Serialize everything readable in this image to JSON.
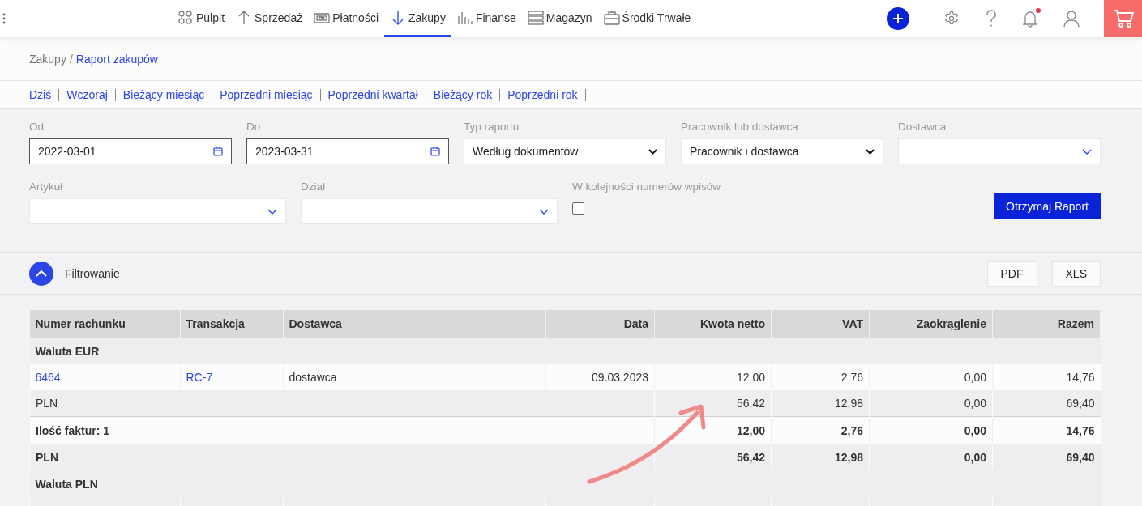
{
  "nav": {
    "items": [
      {
        "label": "Pulpit",
        "selected": false
      },
      {
        "label": "Sprzedaż",
        "selected": false
      },
      {
        "label": "Płatności",
        "selected": false
      },
      {
        "label": "Zakupy",
        "selected": true
      },
      {
        "label": "Finanse",
        "selected": false
      },
      {
        "label": "Magazyn",
        "selected": false
      },
      {
        "label": "Środki Trwałe",
        "selected": false
      }
    ],
    "notifications_unread": true
  },
  "breadcrumb": {
    "items": [
      "Zakupy",
      "Raport zakupów"
    ],
    "separator": "/"
  },
  "quick_ranges": [
    "Dziś",
    "Wczoraj",
    "Bieżący miesiąc",
    "Poprzedni miesiąc",
    "Poprzedni kwartał",
    "Bieżący rok",
    "Poprzedni rok"
  ],
  "filters": {
    "row_1": [
      {
        "kind": "date",
        "label": "Od",
        "value": "2022-03-01"
      },
      {
        "kind": "date",
        "label": "Do",
        "value": "2023-03-31"
      },
      {
        "kind": "select",
        "label": "Typ raportu",
        "value": "Według dokumentów"
      },
      {
        "kind": "select",
        "label": "Pracownik lub dostawca",
        "value": "Pracownik i dostawca"
      },
      {
        "kind": "combo",
        "label": "Dostawca"
      }
    ],
    "row_2": [
      {
        "kind": "combo",
        "label": "Artykuł"
      },
      {
        "kind": "combo",
        "label": "Dział"
      },
      {
        "kind": "checkbox",
        "label": "W kolejności numerów wpisów",
        "checked": false
      }
    ],
    "submit": "Otrzymaj Raport"
  },
  "filter_bar": {
    "label": "Filtrowanie",
    "expanded": true,
    "exports": [
      "PDF",
      "XLS"
    ]
  },
  "table": {
    "columns": [
      "Numer rachunku",
      "Transakcja",
      "Dostawca",
      "Data",
      "Kwota netto",
      "VAT",
      "Zaokrąglenie",
      "Razem"
    ],
    "rows": [
      {
        "kind": "group",
        "label": "Waluta EUR"
      },
      {
        "kind": "item",
        "number": "6464",
        "transaction": "RC-7",
        "supplier": "dostawca",
        "date": "09.03.2023",
        "net": "12,00",
        "vat": "2,76",
        "rounding": "0,00",
        "total": "14,76"
      },
      {
        "kind": "currency",
        "label": "PLN",
        "net": "56,42",
        "vat": "12,98",
        "rounding": "0,00",
        "total": "69,40"
      },
      {
        "kind": "summary",
        "label": "Ilość faktur: 1",
        "net": "12,00",
        "vat": "2,76",
        "rounding": "0,00",
        "total": "14,76"
      },
      {
        "kind": "summary_currency",
        "label": "PLN",
        "net": "56,42",
        "vat": "12,98",
        "rounding": "0,00",
        "total": "69,40"
      },
      {
        "kind": "group",
        "label": "Waluta PLN"
      }
    ]
  }
}
